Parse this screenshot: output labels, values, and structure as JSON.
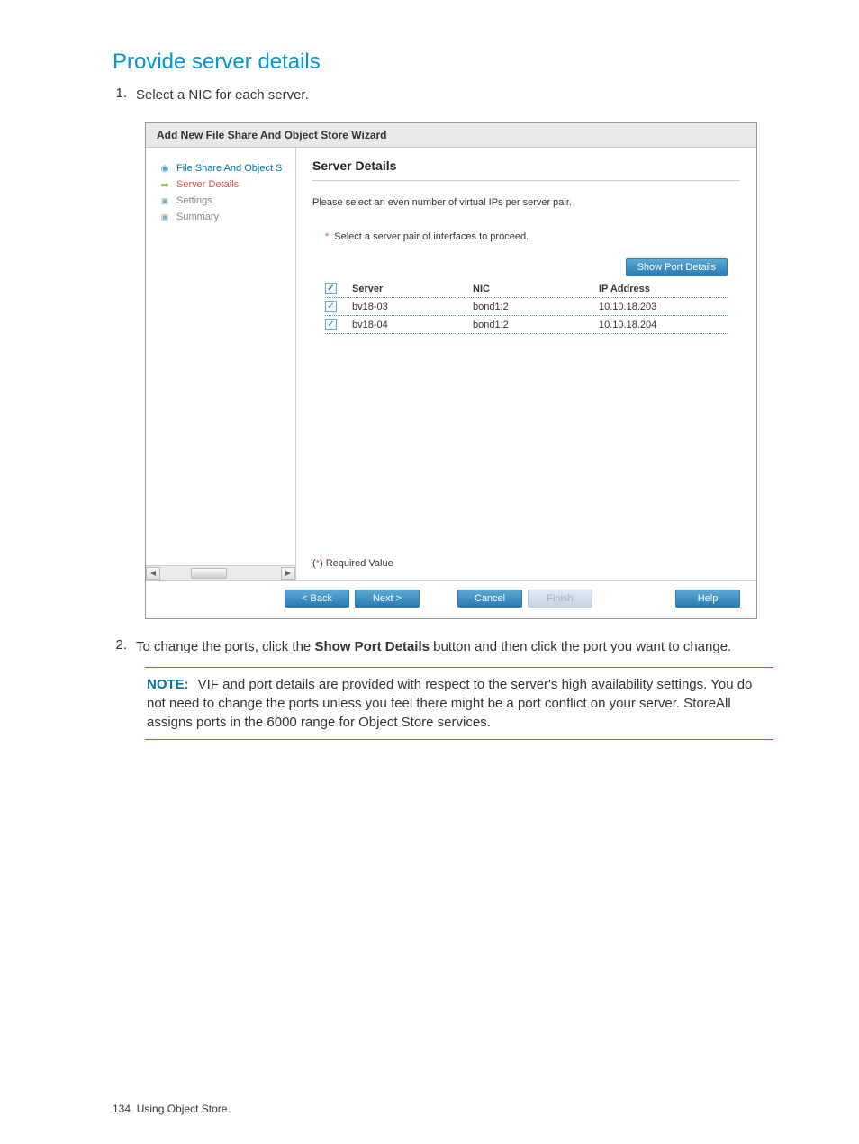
{
  "section_title": "Provide server details",
  "step1_num": "1.",
  "step1_text": "Select a NIC for each server.",
  "wizard": {
    "title": "Add New File Share And Object Store Wizard",
    "sidebar": {
      "items": [
        {
          "label": "File Share And Object S",
          "icon": "radio-blue"
        },
        {
          "label": "Server Details",
          "icon": "arrow-green"
        },
        {
          "label": "Settings",
          "icon": "square"
        },
        {
          "label": "Summary",
          "icon": "square"
        }
      ]
    },
    "main": {
      "heading": "Server Details",
      "desc": "Please select an even number of virtual IPs per server pair.",
      "select_row": "Select a server pair of interfaces to proceed.",
      "show_port_btn": "Show Port Details",
      "columns": {
        "server": "Server",
        "nic": "NIC",
        "ip": "IP Address"
      },
      "rows": [
        {
          "server": "bv18-03",
          "nic": "bond1:2",
          "ip": "10.10.18.203"
        },
        {
          "server": "bv18-04",
          "nic": "bond1:2",
          "ip": "10.10.18.204"
        }
      ],
      "required_value": "Required Value",
      "star": "*"
    },
    "footer": {
      "back": "< Back",
      "next": "Next >",
      "cancel": "Cancel",
      "finish": "Finish",
      "help": "Help"
    }
  },
  "step2_num": "2.",
  "step2_pre": "To change the ports, click the ",
  "step2_bold": "Show Port Details",
  "step2_post": " button and then click the port you want to change.",
  "note": {
    "label": "NOTE:",
    "text": "VIF and port details are provided with respect to the server's high availability settings. You do not need to change the ports unless you feel there might be a port conflict on your server. StoreAll assigns ports in the 6000 range for Object Store services."
  },
  "page_footer_num": "134",
  "page_footer_text": "Using Object Store"
}
